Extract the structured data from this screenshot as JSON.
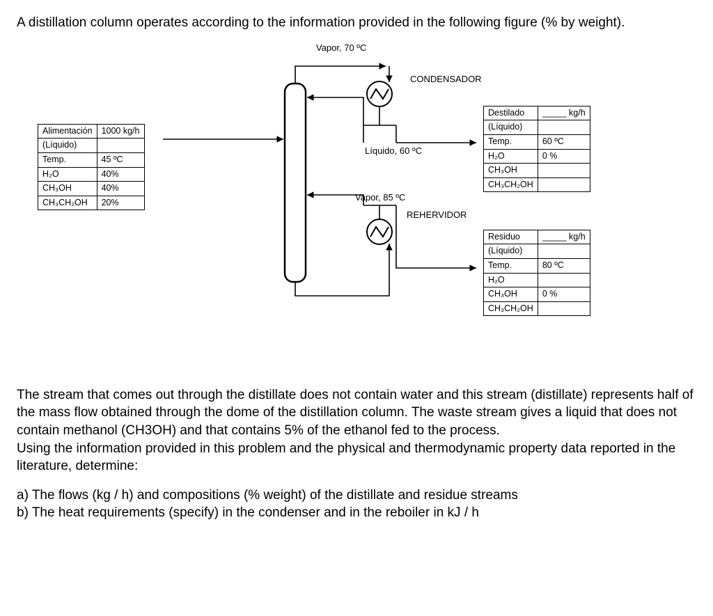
{
  "intro": "A distillation column operates according to the information provided in the following figure (% by weight).",
  "labels": {
    "vapor70": "Vapor, 70 ºC",
    "condenser": "CONDENSADOR",
    "liquid60": "Líquido, 60 ºC",
    "vapor85": "Vapor, 85 ºC",
    "reboiler": "REHERVIDOR"
  },
  "feed": {
    "titleA": "Alimentación",
    "titleB": "1000 kg/h",
    "sub": "(Líquido)",
    "rows": [
      [
        "Temp.",
        "45 ºC"
      ],
      [
        "H₂O",
        "40%"
      ],
      [
        "CH₃OH",
        "40%"
      ],
      [
        "CH₃CH₂OH",
        "20%"
      ]
    ]
  },
  "distillate": {
    "titleA": "Destilado",
    "titleB": "_____ kg/h",
    "sub": "(Líquido)",
    "rows": [
      [
        "Temp.",
        "60 ºC"
      ],
      [
        "H₂O",
        "0 %"
      ],
      [
        "CH₃OH",
        ""
      ],
      [
        "CH₃CH₂OH",
        ""
      ]
    ]
  },
  "residue": {
    "titleA": "Residuo",
    "titleB": "_____ kg/h",
    "sub": "(Líquido)",
    "rows": [
      [
        "Temp.",
        "80 ºC"
      ],
      [
        "H₂O",
        ""
      ],
      [
        "CH₃OH",
        "0 %"
      ],
      [
        "CH₃CH₂OH",
        ""
      ]
    ]
  },
  "para1": "The stream that comes out through the distillate does not contain water and this stream (distillate) represents half of the mass flow obtained through the dome of the distillation column. The waste stream gives a liquid that does not contain methanol (CH3OH) and that contains 5% of the ethanol fed to the process.",
  "para2": "Using the information provided in this problem and the physical and thermodynamic property data reported in the literature, determine:",
  "qa": "a) The flows (kg / h) and compositions (% weight) of the distillate and residue streams",
  "qb": "b) The heat requirements (specify) in the condenser and in the reboiler in kJ / h"
}
